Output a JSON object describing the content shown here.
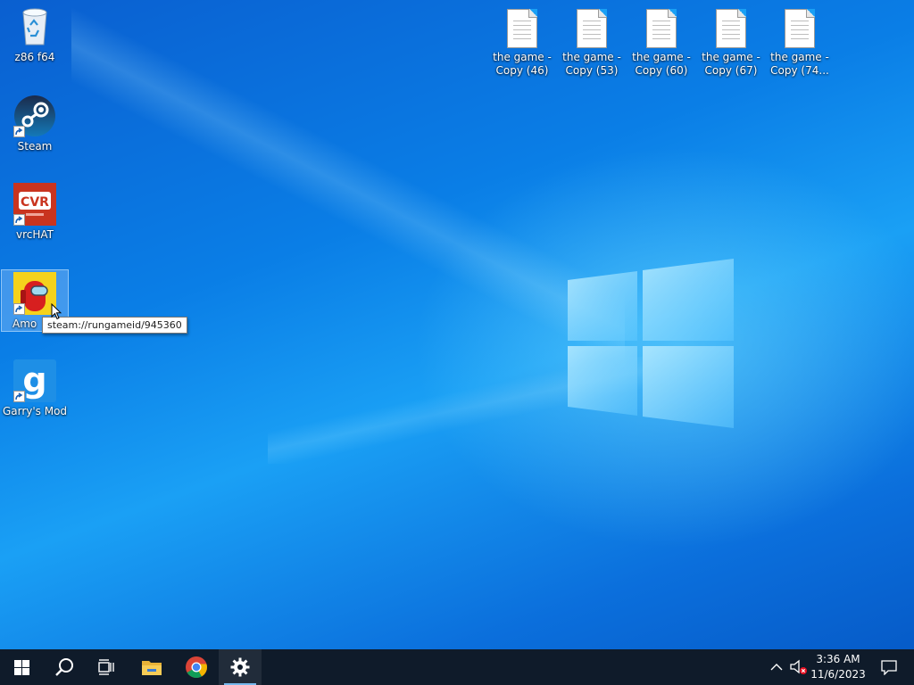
{
  "desktop": {
    "icons_left": [
      {
        "label": "z86 f64",
        "icon": "recycle-bin-icon"
      },
      {
        "label": "Steam",
        "icon": "steam-icon"
      },
      {
        "label": "vrcHAT",
        "icon": "vrchat-icon",
        "logo_text": "CVR"
      },
      {
        "label": "Among Us",
        "label_visible": "Amo",
        "icon": "among-us-icon"
      },
      {
        "label": "Garry's Mod",
        "icon": "garrys-mod-icon",
        "logo_text": "g"
      }
    ],
    "icons_top": [
      {
        "label": "the game - Copy (46)",
        "icon": "text-file-icon"
      },
      {
        "label": "the game - Copy (53)",
        "icon": "text-file-icon"
      },
      {
        "label": "the game - Copy (60)",
        "icon": "text-file-icon"
      },
      {
        "label": "the game - Copy (67)",
        "icon": "text-file-icon"
      },
      {
        "label": "the game - Copy (74...",
        "icon": "text-file-icon"
      }
    ],
    "tooltip": "steam://rungameid/945360"
  },
  "taskbar": {
    "buttons": [
      {
        "name": "start-button",
        "icon": "windows-start-icon"
      },
      {
        "name": "search-button",
        "icon": "search-icon"
      },
      {
        "name": "task-view-button",
        "icon": "task-view-icon"
      },
      {
        "name": "file-explorer-button",
        "icon": "folder-icon"
      },
      {
        "name": "chrome-button",
        "icon": "chrome-icon"
      },
      {
        "name": "settings-button",
        "icon": "gear-icon",
        "active": true
      }
    ],
    "tray": {
      "show_hidden_icon": "chevron-up-icon",
      "volume_icon": "volume-muted-icon",
      "time": "3:36 AM",
      "date": "11/6/2023",
      "notification_icon": "action-center-icon"
    }
  },
  "colors": {
    "wallpaper_blue": "#0a7ee6",
    "taskbar": "#0f1b2a",
    "accent": "#76b9ed"
  }
}
